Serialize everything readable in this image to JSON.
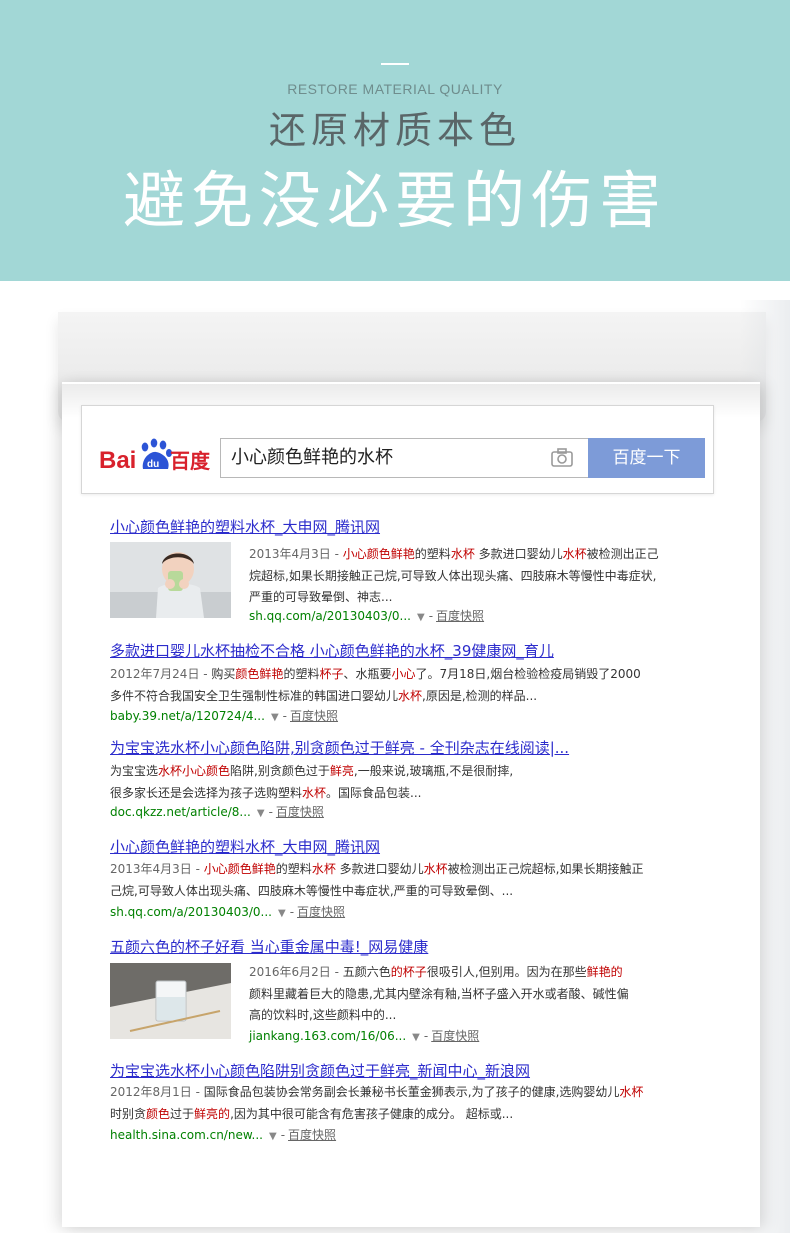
{
  "banner": {
    "en": "RESTORE MATERIAL QUALITY",
    "sub": "还原材质本色",
    "main": "避免没必要的伤害",
    "bg_color": "#a2d7d6"
  },
  "search": {
    "logo_bai": "Bai",
    "logo_du": "du",
    "logo_cn": "百度",
    "query": "小心颜色鲜艳的水杯",
    "button": "百度一下",
    "camera_icon": "camera-icon"
  },
  "results": [
    {
      "title": "小心颜色鲜艳的塑料水杯_大申网_腾讯网",
      "date": "2013年4月3日 - ",
      "s1": "小心颜色鲜艳",
      "s2": "的塑料",
      "s3": "水杯",
      "s4": " 多款进口婴幼儿",
      "s5": "水杯",
      "s6": "被检测出正己烷超标,如果长期接触正己烷,可导致人体出现头痛、四肢麻木等慢性中毒症状,严重的可导致晕倒、神志...",
      "url": "sh.qq.com/a/20130403/0...",
      "cache": "百度快照",
      "thumb": "child-drinking-cup"
    },
    {
      "title": "多款进口婴儿水杯抽检不合格 小心颜色鲜艳的水杯_39健康网_育儿",
      "date": "2012年7月24日 - ",
      "s1": "购买",
      "s2": "颜色鲜艳",
      "s3": "的塑料",
      "s4": "杯子",
      "s5": "、水瓶要",
      "s6": "小心",
      "s7": "了。7月18日,烟台检验检疫局销毁了2000多件不符合我国安全卫生强制性标准的韩国进口婴幼儿",
      "s8": "水杯",
      "s9": ",原因是,检测的样品...",
      "url": "baby.39.net/a/120724/4...",
      "cache": "百度快照"
    },
    {
      "title": "为宝宝选水杯小心颜色陷阱,别贪颜色过于鲜亮 - 全刊杂志在线阅读|...",
      "s1": "为宝宝选",
      "s2": "水杯小心颜色",
      "s3": "陷阱,别贪颜色过于",
      "s4": "鲜亮",
      "s5": ",一般来说,玻璃瓶,不是很耐摔,很多家长还是会选择为孩子选购塑料",
      "s6": "水杯",
      "s7": "。国际食品包装...",
      "url": "doc.qkzz.net/article/8...",
      "cache": "百度快照"
    },
    {
      "title": "小心颜色鲜艳的塑料水杯_大申网_腾讯网",
      "date": "2013年4月3日 - ",
      "s1": "小心颜色鲜艳",
      "s2": "的塑料",
      "s3": "水杯",
      "s4": " 多款进口婴幼儿",
      "s5": "水杯",
      "s6": "被检测出正己烷超标,如果长期接触正己烷,可导致人体出现头痛、四肢麻木等慢性中毒症状,严重的可导致晕倒、...",
      "url": "sh.qq.com/a/20130403/0...",
      "cache": "百度快照"
    },
    {
      "title": "五颜六色的杯子好看 当心重金属中毒!_网易健康",
      "date": "2016年6月2日 - ",
      "s1": "五颜六色",
      "s2": "的杯子",
      "s3": "很吸引人,但别用。因为在那些",
      "s4": "鲜艳的",
      "s5": "颜料里藏着巨大的隐患,尤其内壁涂有釉,当杯子盛入开水或者酸、碱性偏高的饮料时,这些颜料中的...",
      "url": "jiankang.163.com/16/06...",
      "cache": "百度快照",
      "thumb": "glass-cup"
    },
    {
      "title": "为宝宝选水杯小心颜色陷阱别贪颜色过于鲜亮_新闻中心_新浪网",
      "date": "2012年8月1日 - ",
      "s1": "国际食品包装协会常务副会长兼秘书长董金狮表示,为了孩子的健康,选购婴幼儿",
      "s2": "水杯",
      "s3": "时别贪",
      "s4": "颜色",
      "s5": "过于",
      "s6": "鲜亮的",
      "s7": ",因为其中很可能含有危害孩子健康的成分。 超标或...",
      "url": "health.sina.com.cn/new...",
      "cache": "百度快照"
    }
  ]
}
